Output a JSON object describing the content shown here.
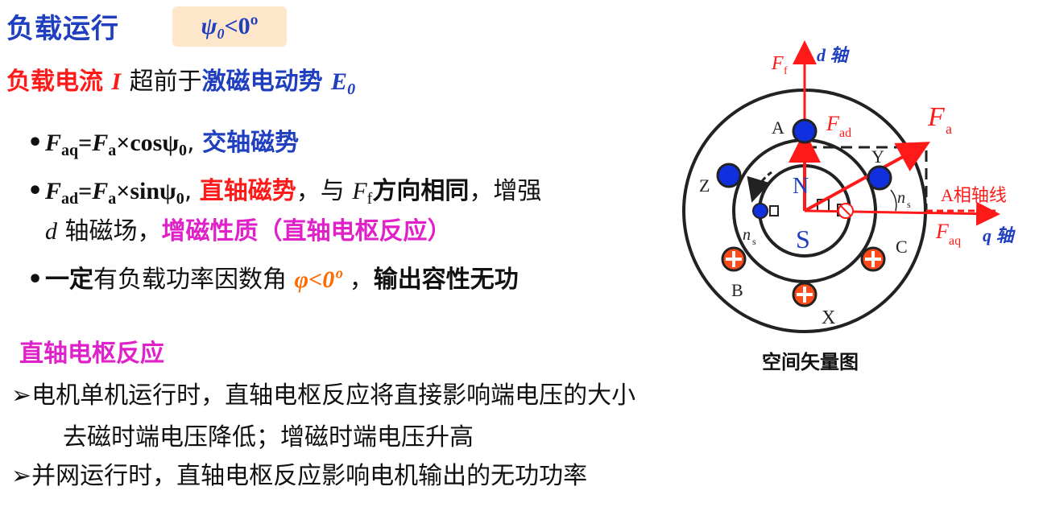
{
  "heading": {
    "title": "负载运行",
    "condition_symbol": "ψ",
    "condition_sub": "0",
    "condition_rest": "<0º"
  },
  "subtitle": {
    "part1": "负载电流",
    "current_symbol": "I",
    "part2": "超前于",
    "part3": "激磁电动势",
    "emf_symbol": "E",
    "emf_sub": "0"
  },
  "bullets": {
    "b1": {
      "F": "F",
      "aq": "aq",
      "eq": "=",
      "F2": "F",
      "a": "a",
      "expr": "×cosψ",
      "psi_sub": "0",
      "comma": ",",
      "label": "交轴磁势"
    },
    "b2": {
      "F": "F",
      "ad": "ad",
      "eq": "=",
      "F2": "F",
      "a": "a",
      "expr": "×sinψ",
      "psi_sub": "0",
      "comma": ",",
      "label": "直轴磁势",
      "text1": "，与",
      "Ff": "F",
      "f_sub": "f",
      "text2": "方向相同",
      "text3": "，增强",
      "d_sym": "d",
      "text4": "轴磁场，",
      "text5": "增磁性质（直轴电枢反应）"
    },
    "b3": {
      "bold1": "一定",
      "text1": "有负载功率因数角",
      "phi": "φ<0º",
      "text2": "，",
      "bold2": "输出容性无功"
    }
  },
  "section": {
    "title": "直轴电枢反应",
    "item1_line1": "电机单机运行时，直轴电枢反应将直接影响端电压的大小",
    "item1_line2": "去磁时端电压降低；增磁时端电压升高",
    "item2": "并网运行时，直轴电枢反应影响电机输出的无功功率",
    "marker": "➢"
  },
  "diagram": {
    "caption": "空间矢量图",
    "d_axis": "d 轴",
    "q_axis": "q 轴",
    "Ff": "F",
    "Ff_sub": "f",
    "Fad": "F",
    "Fad_sub": "ad",
    "Fa": "F",
    "Fa_sub": "a",
    "Faq": "F",
    "Faq_sub": "aq",
    "a_axis": "A相轴线",
    "ns": "n",
    "ns_sub": "s",
    "coils": {
      "A": "A",
      "B": "B",
      "C": "C",
      "X": "X",
      "Y": "Y",
      "Z": "Z"
    },
    "pole_N": "N",
    "pole_S": "S",
    "colors": {
      "arrow": "#ff1a1a",
      "dot": "#1030e0",
      "cross": "#ff4a1a",
      "pole": "#1f3fbf"
    }
  }
}
